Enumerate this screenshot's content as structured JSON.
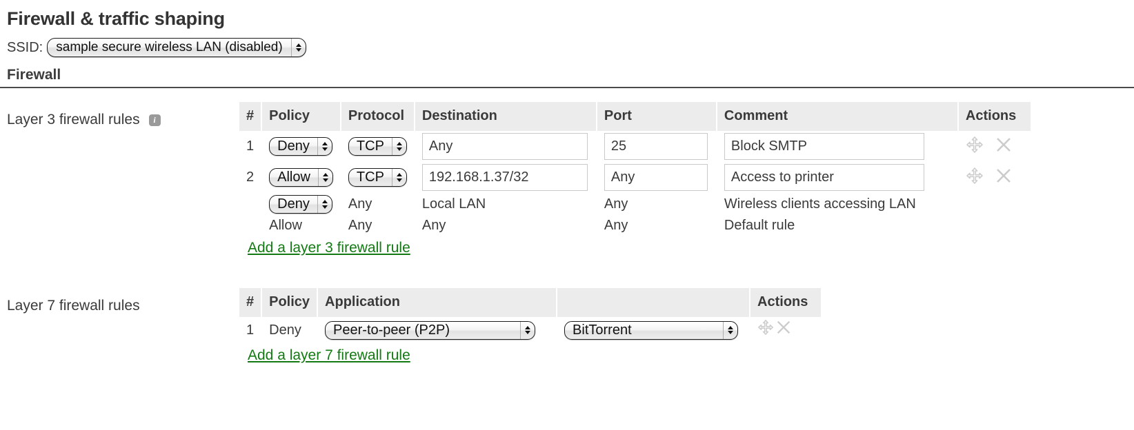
{
  "page": {
    "title": "Firewall & traffic shaping",
    "ssid_label": "SSID:",
    "ssid_value": "sample secure wireless LAN (disabled)",
    "section_firewall": "Firewall"
  },
  "colors": {
    "link_green": "#137a13",
    "header_bg": "#ececec",
    "text": "#3a3a3a",
    "icon_gray": "#cccccc"
  },
  "layer3": {
    "label": "Layer 3 firewall rules",
    "info_icon": "info-icon",
    "info_glyph": "i",
    "columns": [
      "#",
      "Policy",
      "Protocol",
      "Destination",
      "Port",
      "Comment",
      "Actions"
    ],
    "rows": [
      {
        "num": "1",
        "policy": "Deny",
        "policy_editable": true,
        "protocol": "TCP",
        "protocol_editable": true,
        "destination": "Any",
        "destination_editable": true,
        "port": "25",
        "port_editable": true,
        "comment": "Block SMTP",
        "comment_editable": true,
        "actions": true
      },
      {
        "num": "2",
        "policy": "Allow",
        "policy_editable": true,
        "protocol": "TCP",
        "protocol_editable": true,
        "destination": "192.168.1.37/32",
        "destination_editable": true,
        "port": "Any",
        "port_editable": true,
        "comment": "Access to printer",
        "comment_editable": true,
        "actions": true
      },
      {
        "num": "",
        "policy": "Deny",
        "policy_editable": true,
        "protocol": "Any",
        "protocol_editable": false,
        "destination": "Local LAN",
        "destination_editable": false,
        "port": "Any",
        "port_editable": false,
        "comment": "Wireless clients accessing LAN",
        "comment_editable": false,
        "actions": false
      },
      {
        "num": "",
        "policy": "Allow",
        "policy_editable": false,
        "protocol": "Any",
        "protocol_editable": false,
        "destination": "Any",
        "destination_editable": false,
        "port": "Any",
        "port_editable": false,
        "comment": "Default rule",
        "comment_editable": false,
        "actions": false
      }
    ],
    "add_link": "Add a layer 3 firewall rule"
  },
  "layer7": {
    "label": "Layer 7 firewall rules",
    "columns": [
      "#",
      "Policy",
      "Application",
      "",
      "Actions"
    ],
    "rows": [
      {
        "num": "1",
        "policy": "Deny",
        "application": "Peer-to-peer (P2P)",
        "application_detail": "BitTorrent",
        "actions": true
      }
    ],
    "add_link": "Add a layer 7 firewall rule"
  }
}
